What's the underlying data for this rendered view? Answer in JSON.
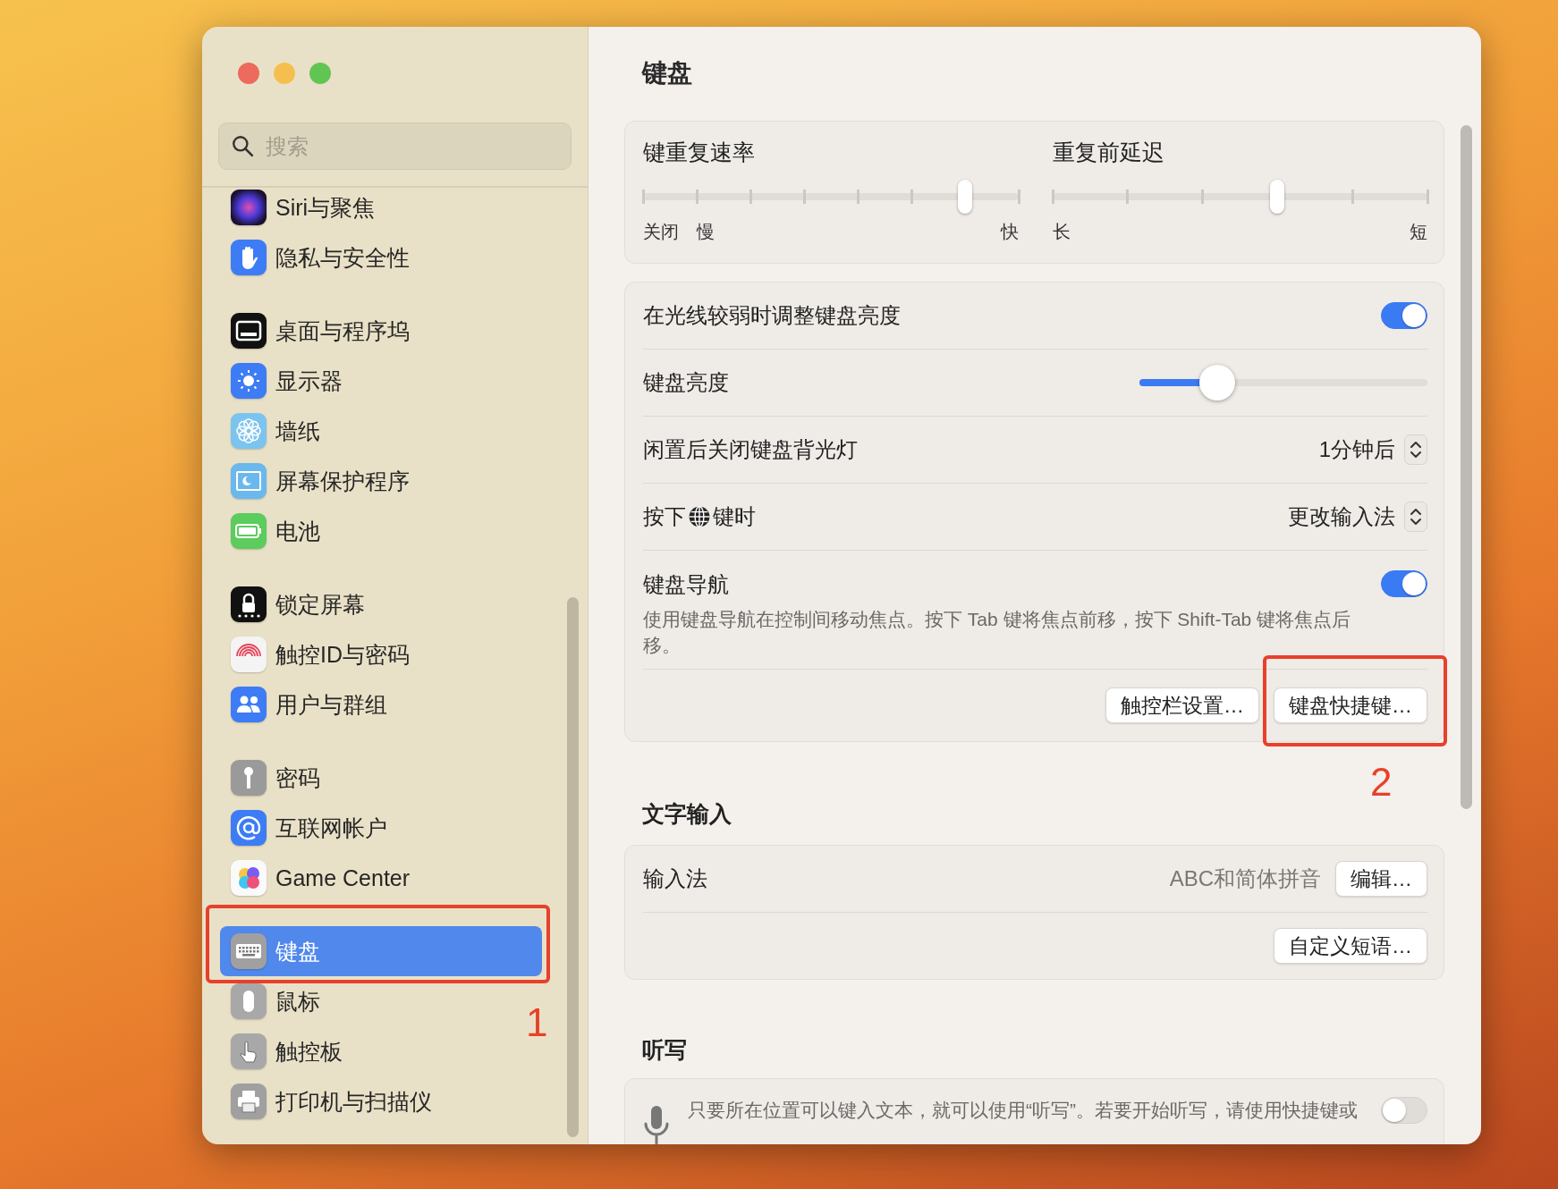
{
  "sidebar": {
    "search": {
      "placeholder": "搜索"
    },
    "groups": [
      {
        "items": [
          {
            "label": "Siri与聚焦",
            "selected": false
          },
          {
            "label": "隐私与安全性",
            "selected": false
          }
        ]
      },
      {
        "items": [
          {
            "label": "桌面与程序坞",
            "selected": false
          },
          {
            "label": "显示器",
            "selected": false
          },
          {
            "label": "墙纸",
            "selected": false
          },
          {
            "label": "屏幕保护程序",
            "selected": false
          },
          {
            "label": "电池",
            "selected": false
          }
        ]
      },
      {
        "items": [
          {
            "label": "锁定屏幕",
            "selected": false
          },
          {
            "label": "触控ID与密码",
            "selected": false
          },
          {
            "label": "用户与群组",
            "selected": false
          }
        ]
      },
      {
        "items": [
          {
            "label": "密码",
            "selected": false
          },
          {
            "label": "互联网帐户",
            "selected": false
          },
          {
            "label": "Game Center",
            "selected": false
          }
        ]
      },
      {
        "items": [
          {
            "label": "键盘",
            "selected": true,
            "annotation": "1"
          },
          {
            "label": "鼠标",
            "selected": false
          },
          {
            "label": "触控板",
            "selected": false
          },
          {
            "label": "打印机与扫描仪",
            "selected": false
          }
        ]
      }
    ]
  },
  "content": {
    "title": "键盘",
    "repeat_sliders": [
      {
        "label": "键重复速率",
        "level": 0.857,
        "start_labels": [
          "关闭",
          "慢"
        ],
        "end_label": "快"
      },
      {
        "label": "重复前延迟",
        "level": 0.6,
        "start_labels": [
          "长"
        ],
        "end_label": "短"
      }
    ],
    "settings": [
      {
        "kind": "toggle",
        "label": "在光线较弱时调整键盘亮度",
        "on": true
      },
      {
        "kind": "slider",
        "label": "键盘亮度",
        "level": 0.27
      },
      {
        "kind": "popup",
        "label": "闲置后关闭键盘背光灯",
        "value": "1分钟后"
      },
      {
        "kind": "popup",
        "label": "按下",
        "label_after_icon": "键时",
        "value": "更改输入法"
      },
      {
        "kind": "toggle",
        "label": "键盘导航",
        "description": "使用键盘导航在控制间移动焦点。按下 Tab 键将焦点前移，按下 Shift-Tab 键将焦点后移。",
        "on": true
      }
    ],
    "buttons": [
      {
        "label": "触控栏设置…"
      },
      {
        "label": "键盘快捷键…",
        "annotation": "2"
      }
    ],
    "text_input": {
      "title": "文字输入",
      "rows": [
        {
          "kind": "value_button",
          "label": "输入法",
          "value": "ABC和简体拼音",
          "button": "编辑…"
        },
        {
          "kind": "button",
          "button": "自定义短语…"
        }
      ]
    },
    "dictation": {
      "title": "听写",
      "description": "只要所在位置可以键入文本，就可以使用“听写”。若要开始听写，请使用快捷键或",
      "on": false
    }
  }
}
